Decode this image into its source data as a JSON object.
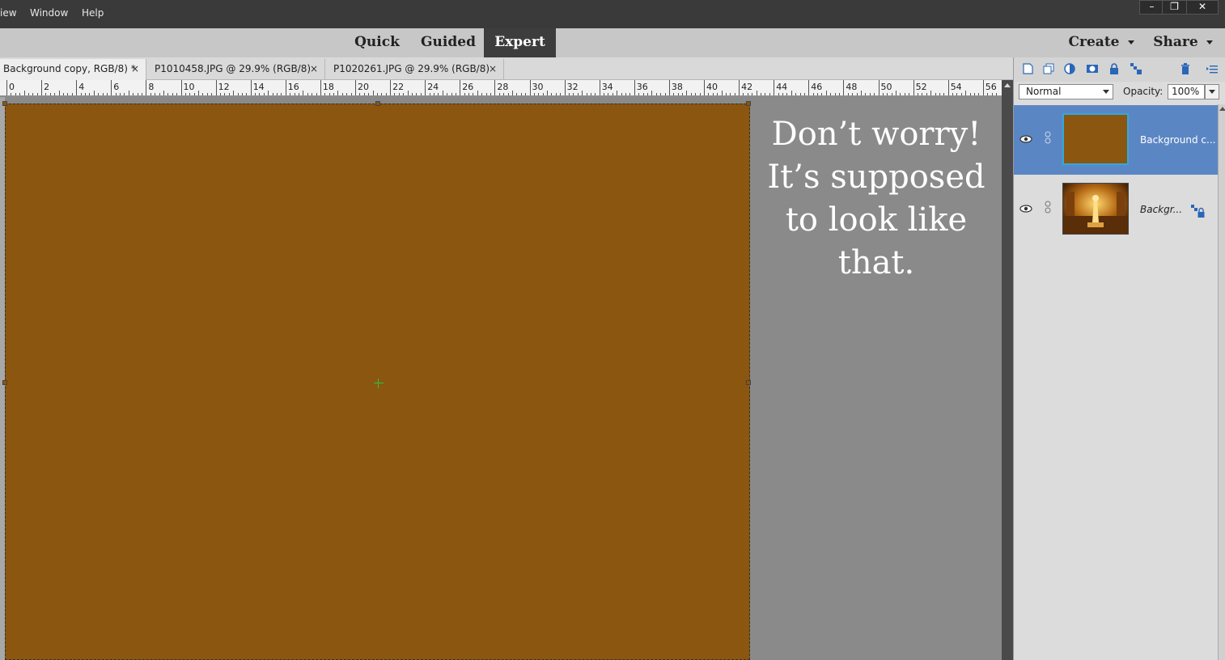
{
  "menu": {
    "items": [
      "iew",
      "Window",
      "Help"
    ]
  },
  "window_controls": {
    "minimize": "–",
    "restore": "❐",
    "close": "✕"
  },
  "modes": {
    "quick": "Quick",
    "guided": "Guided",
    "expert": "Expert",
    "active": "Expert"
  },
  "actions": {
    "create": "Create",
    "share": "Share"
  },
  "doc_tabs": [
    {
      "label": "Background copy, RGB/8) *",
      "close": "×",
      "active": true
    },
    {
      "label": "P1010458.JPG @ 29.9% (RGB/8)",
      "close": "×",
      "active": false
    },
    {
      "label": "P1020261.JPG @ 29.9% (RGB/8)",
      "close": "×",
      "active": false
    }
  ],
  "ruler": {
    "labels": [
      "0",
      "2",
      "4",
      "6",
      "8",
      "10",
      "12",
      "14",
      "16",
      "18",
      "20",
      "22",
      "24",
      "26",
      "28",
      "30",
      "32",
      "34",
      "36",
      "38",
      "40",
      "42",
      "44",
      "46",
      "48",
      "50",
      "52",
      "54",
      "56"
    ]
  },
  "canvas": {
    "fill_color": "#8b560f",
    "workspace_color": "#8a8a8a"
  },
  "annotation": {
    "lines": [
      "Don’t worry!",
      "It’s supposed",
      "to look like that."
    ]
  },
  "layers_panel": {
    "toolbar_icons": [
      "new-layer-icon",
      "new-group-icon",
      "adjustment-layer-icon",
      "layer-mask-icon",
      "lock-all-icon",
      "lock-transparent-icon",
      "delete-layer-icon",
      "panel-menu-icon"
    ],
    "blend_mode": "Normal",
    "opacity_label": "Opacity:",
    "opacity_value": "100%",
    "layers": [
      {
        "name": "Background c...",
        "selected": true,
        "thumb_color": "#8b560f"
      },
      {
        "name": "Backgr...",
        "selected": false,
        "locked": true
      }
    ]
  }
}
